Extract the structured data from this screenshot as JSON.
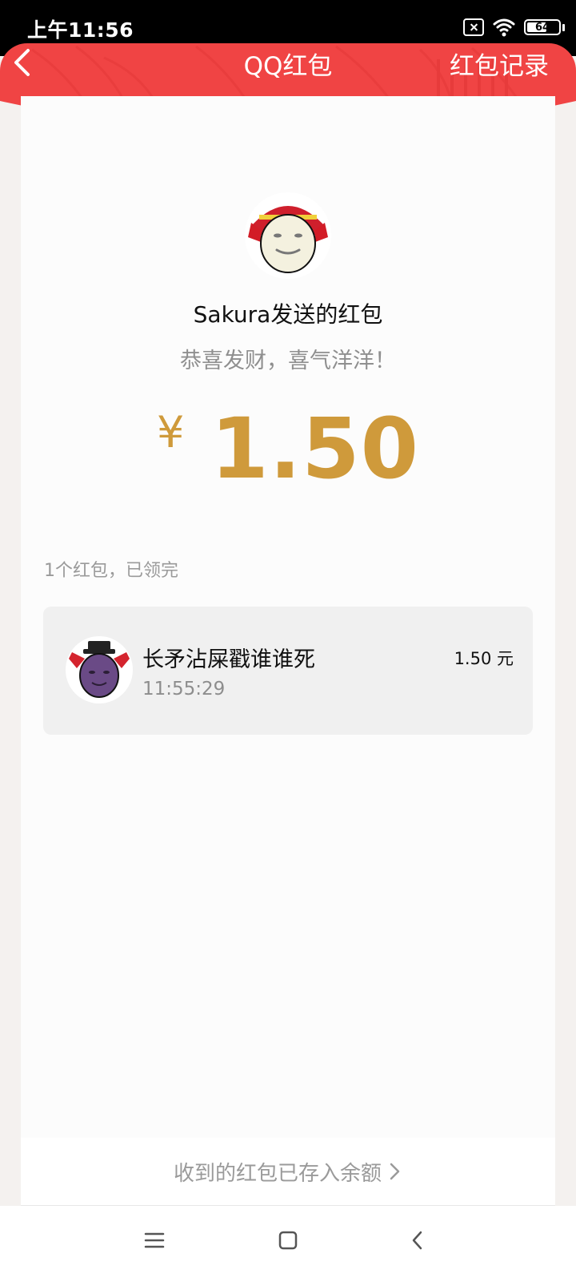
{
  "status_bar": {
    "time": "上午11:56",
    "battery": "64",
    "battery_level": 0.64,
    "icons": [
      "sim-card-icon",
      "wifi-icon",
      "battery-icon"
    ]
  },
  "header": {
    "title": "QQ红包",
    "record_link": "红包记录",
    "back_icon": "back-icon",
    "color": "#f04444"
  },
  "red_packet": {
    "sender_avatar_icon": "sender-avatar",
    "sender_title": "Sakura发送的红包",
    "greeting": "恭喜发财，喜气洋洋！",
    "currency_symbol": "¥",
    "amount": "1.50",
    "amount_color": "#cf9a3b"
  },
  "summary": "1个红包，已领完",
  "recipients": [
    {
      "name": "长矛沾屎戳谁谁死",
      "time": "11:55:29",
      "amount": "1.50 元",
      "avatar_icon": "receiver-avatar"
    }
  ],
  "footer": {
    "balance_link": "收到的红包已存入余额",
    "chevron_icon": "chevron-right-icon"
  },
  "nav": {
    "icons": [
      "menu-icon",
      "home-icon",
      "back-icon"
    ]
  }
}
